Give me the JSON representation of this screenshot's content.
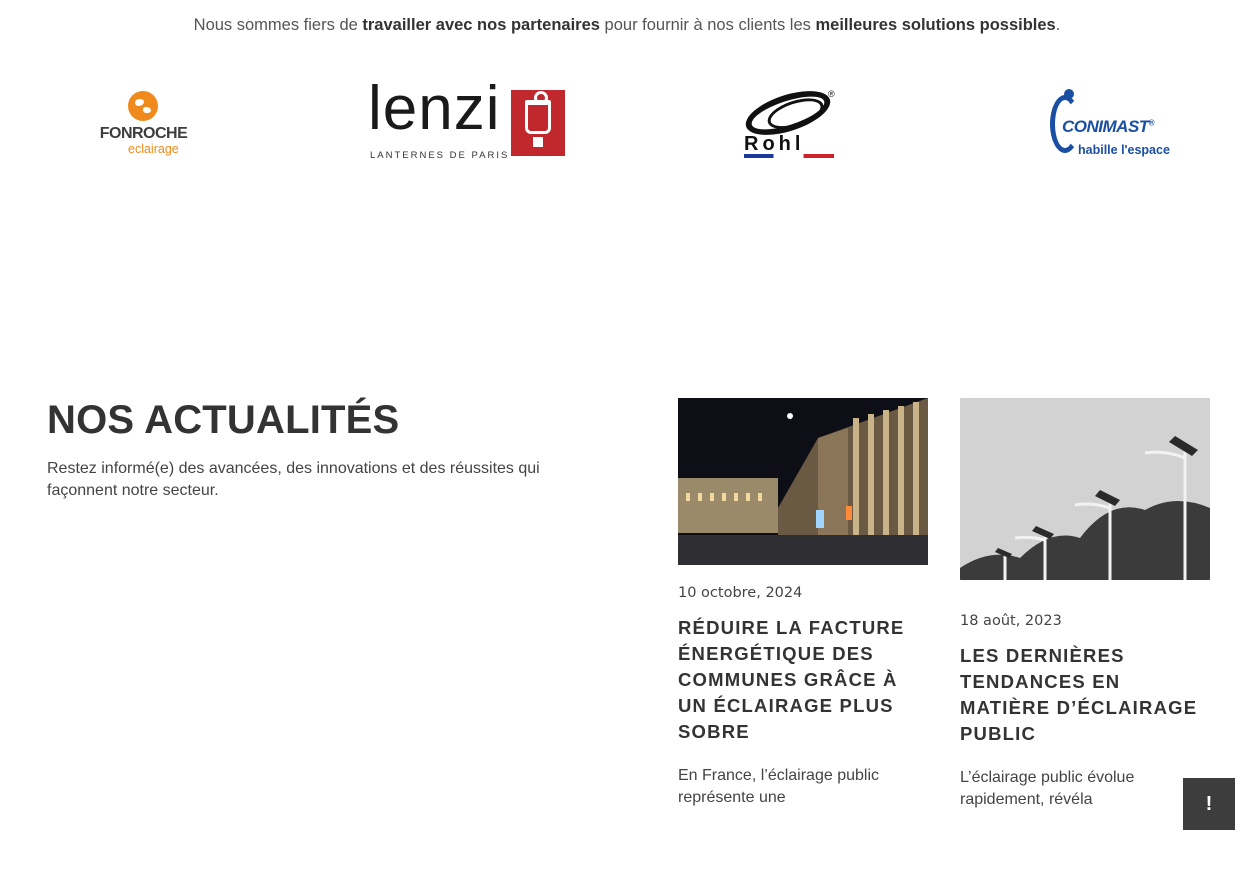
{
  "intro": {
    "part1": "Nous sommes fiers de ",
    "bold1": "travailler avec nos partenaires",
    "part2": " pour fournir à nos clients les ",
    "bold2": "meilleures solutions possibles",
    "part3": "."
  },
  "partners": [
    {
      "name": "FONROCHE",
      "sub": "eclairage",
      "icon": "globe-icon"
    },
    {
      "name": "lenzi",
      "sub": "LANTERNES DE PARIS",
      "icon": "lantern-icon"
    },
    {
      "name": "Rohl",
      "sub": "®",
      "icon": "ring-logo-icon"
    },
    {
      "name": "CONIMAST",
      "reg": "®",
      "sub": "habille l'espace",
      "icon": "conimast-arc-icon"
    }
  ],
  "news": {
    "title": "NOS ACTUALITÉS",
    "subtitle": "Restez informé(e) des avancées, des innovations et des réussites qui façonnent notre secteur.",
    "articles": [
      {
        "date": "10 octobre, 2024",
        "title": "RÉDUIRE LA FACTURE ÉNERGÉTIQUE DES COMMUNES GRÂCE À UN ÉCLAIRAGE PLUS SOBRE",
        "excerpt": "En France, l’éclairage public représente une",
        "image": "night-city-street-photo"
      },
      {
        "date": "18 août, 2023",
        "title": "LES DERNIÈRES TENDANCES EN MATIÈRE D’ÉCLAIRAGE PUBLIC",
        "excerpt": "L’éclairage public évolue rapidement, révéla",
        "image": "solar-street-lights-photo"
      }
    ]
  },
  "fab": {
    "label": "!"
  },
  "colors": {
    "accent_orange": "#f08a1c",
    "lenzi_red": "#c0282d",
    "conimast_blue": "#1b4fa3",
    "fab_bg": "#3d3d3d"
  }
}
